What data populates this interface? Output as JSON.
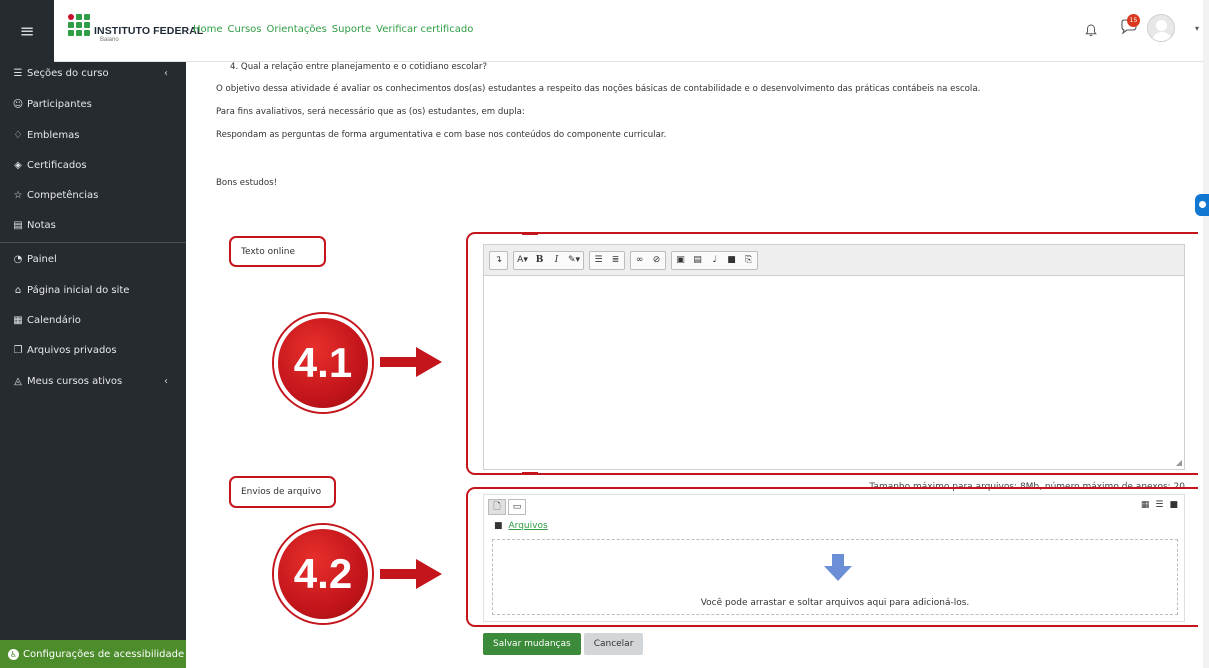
{
  "header": {
    "menu_icon": "hamburger-icon",
    "logo_text": "INSTITUTO FEDERAL",
    "logo_sub": "Baiano",
    "nav": [
      "Home",
      "Cursos",
      "Orientações",
      "Suporte",
      "Verificar certificado"
    ],
    "notification_count": "15"
  },
  "sidebar": {
    "items": [
      {
        "label": "Seções do curso",
        "icon": "list-icon"
      },
      {
        "label": "Participantes",
        "icon": "users-icon"
      },
      {
        "label": "Emblemas",
        "icon": "badge-icon"
      },
      {
        "label": "Certificados",
        "icon": "certificate-icon"
      },
      {
        "label": "Competências",
        "icon": "star-icon"
      },
      {
        "label": "Notas",
        "icon": "grades-icon"
      },
      {
        "label": "Painel",
        "icon": "dashboard-icon"
      },
      {
        "label": "Página inicial do site",
        "icon": "home-icon"
      },
      {
        "label": "Calendário",
        "icon": "calendar-icon"
      },
      {
        "label": "Arquivos privados",
        "icon": "files-icon"
      },
      {
        "label": "Meus cursos ativos",
        "icon": "graduation-cap-icon"
      }
    ],
    "accessibility": "Configurações de acessibilidade"
  },
  "content": {
    "question4": "4. Qual a relação entre planejamento e o cotidiano escolar?",
    "objective": "O objetivo dessa atividade é avaliar os conhecimentos dos(as) estudantes a respeito das noções básicas de contabilidade e o desenvolvimento das práticas contábeis na escola.",
    "evaluation": "Para fins avaliativos, será necessário que as (os) estudantes, em dupla:",
    "instruction": "Respondam as perguntas de forma argumentativa e com base nos conteúdos do componente curricular.",
    "closing": "Bons estudos!"
  },
  "form": {
    "online_text_label": "Texto online",
    "file_upload_label": "Envios de arquivo",
    "marker_41": "4.1",
    "marker_42": "4.2",
    "max_size": "Tamanho máximo para arquivos: 8Mb, número máximo de anexos: 20",
    "files_link": "Arquivos",
    "drop_text": "Você pode arrastar e soltar arquivos aqui para adicioná-los.",
    "save_label": "Salvar mudanças",
    "cancel_label": "Cancelar"
  },
  "colors": {
    "accent_green": "#2f9e44",
    "sidebar_bg": "#262b30",
    "marker_red": "#c3151b",
    "save_button": "#3c8b3a"
  }
}
